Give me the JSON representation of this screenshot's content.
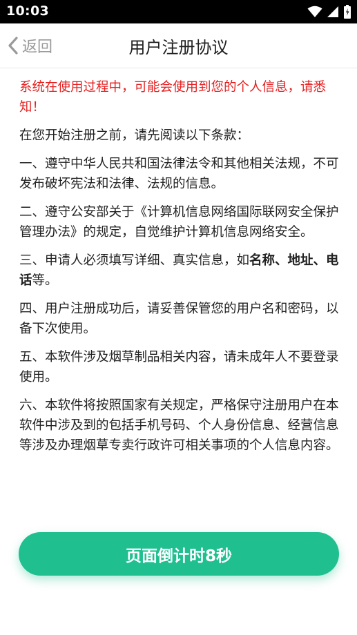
{
  "status_bar": {
    "time": "10:03",
    "icons": [
      "wifi-icon",
      "signal-icon",
      "battery-icon"
    ]
  },
  "nav": {
    "back_label": "返回",
    "title": "用户注册协议"
  },
  "agreement": {
    "warning": "系统在使用过程中，可能会使用到您的个人信息，请悉知！",
    "intro": "在您开始注册之前，请先阅读以下条款：",
    "clause1": "一、遵守中华人民共和国法律法令和其他相关法规，不可发布破坏宪法和法律、法规的信息。",
    "clause2": "二、遵守公安部关于《计算机信息网络国际联网安全保护管理办法》的规定，自觉维护计算机信息网络安全。",
    "clause3_before": "三、申请人必须填写详细、真实信息，如",
    "clause3_bold": "名称、地址、电话",
    "clause3_after": "等。",
    "clause4": "四、用户注册成功后，请妥善保管您的用户名和密码，以备下次使用。",
    "clause5": "五、本软件涉及烟草制品相关内容，请未成年人不要登录使用。",
    "clause6": "六、本软件将按照国家有关规定，严格保守注册用户在本软件中涉及到的包括手机号码、个人身份信息、经营信息等涉及办理烟草专卖行政许可相关事项的个人信息内容。"
  },
  "countdown_button": {
    "label": "页面倒计时8秒"
  },
  "colors": {
    "accent": "#1fbf8f",
    "warning": "#e52020",
    "status_bar": "#000000"
  }
}
